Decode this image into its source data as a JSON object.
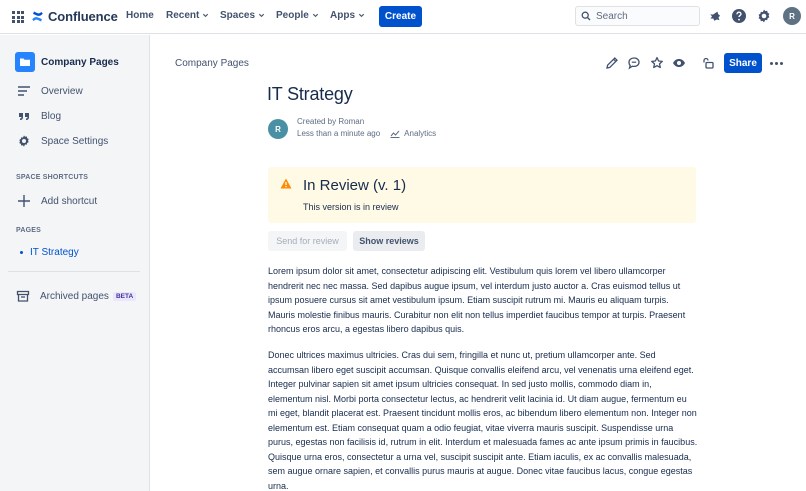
{
  "topnav": {
    "logo_text": "Confluence",
    "items": [
      {
        "label": "Home"
      },
      {
        "label": "Recent"
      },
      {
        "label": "Spaces"
      },
      {
        "label": "People"
      },
      {
        "label": "Apps"
      }
    ],
    "create_label": "Create",
    "search_placeholder": "Search",
    "avatar_initial": "R"
  },
  "sidebar": {
    "space_title": "Company Pages",
    "items": [
      {
        "label": "Overview",
        "icon": "overview-lines-icon"
      },
      {
        "label": "Blog",
        "icon": "quote-icon"
      },
      {
        "label": "Space Settings",
        "icon": "gear-icon"
      }
    ],
    "shortcuts_heading": "SPACE SHORTCUTS",
    "add_shortcut": "Add shortcut",
    "pages_heading": "PAGES",
    "page_item": "IT Strategy",
    "archived_label": "Archived pages",
    "beta_label": "BETA"
  },
  "main": {
    "breadcrumb": "Company Pages",
    "share_label": "Share",
    "title": "IT Strategy",
    "byline": {
      "avatar_initial": "R",
      "created_by": "Created by Roman",
      "time": "Less than a minute ago",
      "analytics": "Analytics"
    },
    "review": {
      "title": "In Review (v. 1)",
      "subtitle": "This version is in review",
      "send_label": "Send for review",
      "show_label": "Show reviews"
    },
    "paragraphs": [
      "Lorem ipsum dolor sit amet, consectetur adipiscing elit. Vestibulum quis lorem vel libero ullamcorper hendrerit nec nec massa. Sed dapibus augue ipsum, vel interdum justo auctor a. Cras euismod tellus ut ipsum posuere cursus sit amet vestibulum ipsum. Etiam suscipit rutrum mi. Mauris eu aliquam turpis. Mauris molestie finibus mauris. Curabitur non elit non tellus imperdiet faucibus tempor at turpis. Praesent rhoncus eros arcu, a egestas libero dapibus quis.",
      "Donec ultrices maximus ultricies. Cras dui sem, fringilla et nunc ut, pretium ullamcorper ante. Sed accumsan libero eget suscipit accumsan. Quisque convallis eleifend arcu, vel venenatis urna eleifend eget. Integer pulvinar sapien sit amet ipsum ultricies consequat. In sed justo mollis, commodo diam in, elementum nisl. Morbi porta consectetur lectus, ac hendrerit velit lacinia id. Ut diam augue, fermentum eu mi eget, blandit placerat est. Praesent tincidunt mollis eros, ac bibendum libero elementum non. Integer non elementum est. Etiam consequat quam a odio feugiat, vitae viverra mauris suscipit. Suspendisse urna purus, egestas non facilisis id, rutrum in elit. Interdum et malesuada fames ac ante ipsum primis in faucibus. Quisque urna eros, consectetur a urna vel, suscipit suscipit ante. Etiam iaculis, ex ac convallis malesuada, sem augue ornare sapien, et convallis purus mauris at augue. Donec vitae faucibus lacus, congue egestas urna."
    ]
  },
  "colors": {
    "primary": "#0052cc",
    "review_bg": "#fffae6",
    "warning": "#ff8b00",
    "sidebar_bg": "#f4f5f7"
  }
}
